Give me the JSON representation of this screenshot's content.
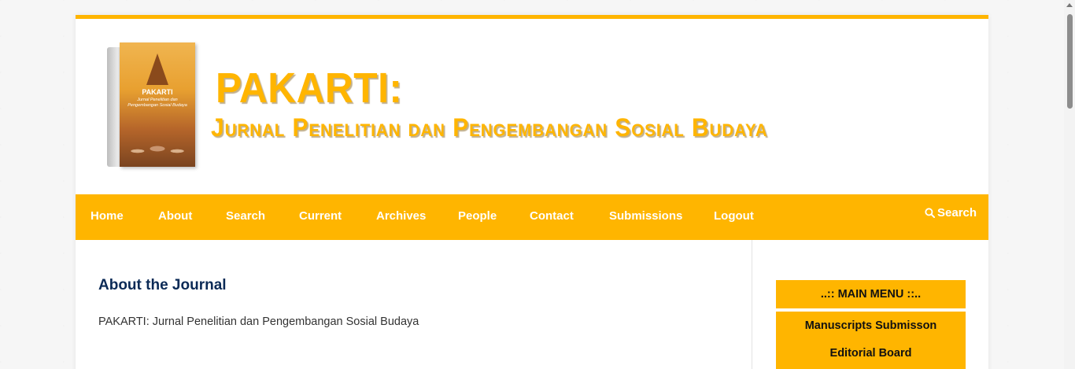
{
  "header": {
    "logo_cover_title": "PAKARTI",
    "logo_cover_subtitle": "Jurnal Penelitian dan Pengembangan Sosial Budaya",
    "title": "PAKARTI:",
    "subtitle": "Jurnal Penelitian dan Pengembangan Sosial Budaya"
  },
  "nav": {
    "items": [
      {
        "label": "Home"
      },
      {
        "label": "About"
      },
      {
        "label": "Search"
      },
      {
        "label": "Current"
      },
      {
        "label": "Archives"
      },
      {
        "label": "People"
      },
      {
        "label": "Contact"
      },
      {
        "label": "Submissions"
      },
      {
        "label": "Logout"
      }
    ],
    "search_label": "Search",
    "search_icon": "search-icon"
  },
  "main": {
    "heading": "About the Journal",
    "text": "PAKARTI: Jurnal Penelitian dan Pengembangan Sosial Budaya"
  },
  "sidebar": {
    "items": [
      {
        "label": "..:: MAIN MENU ::.."
      },
      {
        "label": "Manuscripts Submisson"
      },
      {
        "label": "Editorial Board"
      }
    ]
  },
  "colors": {
    "accent": "#ffb500",
    "heading": "#0b2a56"
  }
}
